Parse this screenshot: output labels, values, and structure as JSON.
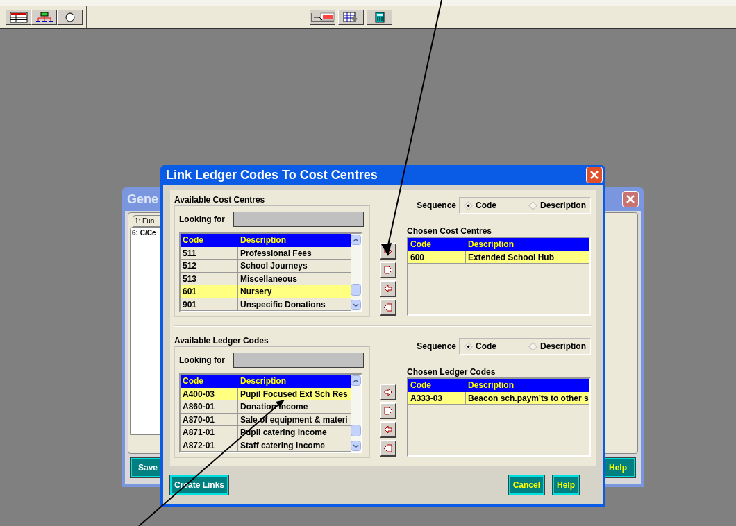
{
  "background_window": {
    "title": "Gene",
    "tabs": [
      {
        "label": "1: Fun",
        "selected": false
      },
      {
        "label": "6: C/Ce",
        "selected": true
      }
    ],
    "buttons": [
      "Save",
      "Help"
    ]
  },
  "dialog": {
    "title": "Link Ledger Codes To Cost Centres",
    "sections": [
      {
        "available": {
          "title": "Available Cost Centres",
          "search_label": "Looking for",
          "columns": [
            "Code",
            "Description"
          ],
          "rows": [
            {
              "code": "511",
              "description": "Professional Fees",
              "selected": false
            },
            {
              "code": "512",
              "description": "School Journeys",
              "selected": false
            },
            {
              "code": "513",
              "description": "Miscellaneous",
              "selected": false
            },
            {
              "code": "601",
              "description": "Nursery",
              "selected": true
            },
            {
              "code": "901",
              "description": "Unspecific Donations",
              "selected": false
            }
          ]
        },
        "sequence": {
          "label": "Sequence",
          "options": [
            {
              "label": "Code",
              "selected": true
            },
            {
              "label": "Description",
              "selected": false
            }
          ]
        },
        "chosen": {
          "title": "Chosen Cost Centres",
          "columns": [
            "Code",
            "Description"
          ],
          "rows": [
            {
              "code": "600",
              "description": "Extended School Hub",
              "selected": true
            }
          ]
        }
      },
      {
        "available": {
          "title": "Available Ledger Codes",
          "search_label": "Looking for",
          "columns": [
            "Code",
            "Description"
          ],
          "rows": [
            {
              "code": "A400-03",
              "description": "Pupil Focused Ext Sch Res",
              "selected": true
            },
            {
              "code": "A860-01",
              "description": "Donation income",
              "selected": false
            },
            {
              "code": "A870-01",
              "description": "Sale of equipment & materi",
              "selected": false
            },
            {
              "code": "A871-01",
              "description": "Pupil catering income",
              "selected": false
            },
            {
              "code": "A872-01",
              "description": "Staff catering income",
              "selected": false
            }
          ]
        },
        "sequence": {
          "label": "Sequence",
          "options": [
            {
              "label": "Code",
              "selected": true
            },
            {
              "label": "Description",
              "selected": false
            }
          ]
        },
        "chosen": {
          "title": "Chosen Ledger Codes",
          "columns": [
            "Code",
            "Description"
          ],
          "rows": [
            {
              "code": "A333-03",
              "description": "Beacon sch.paym'ts to other s",
              "selected": true
            }
          ]
        }
      }
    ],
    "buttons": [
      "Create Links",
      "Cancel",
      "Help"
    ]
  }
}
